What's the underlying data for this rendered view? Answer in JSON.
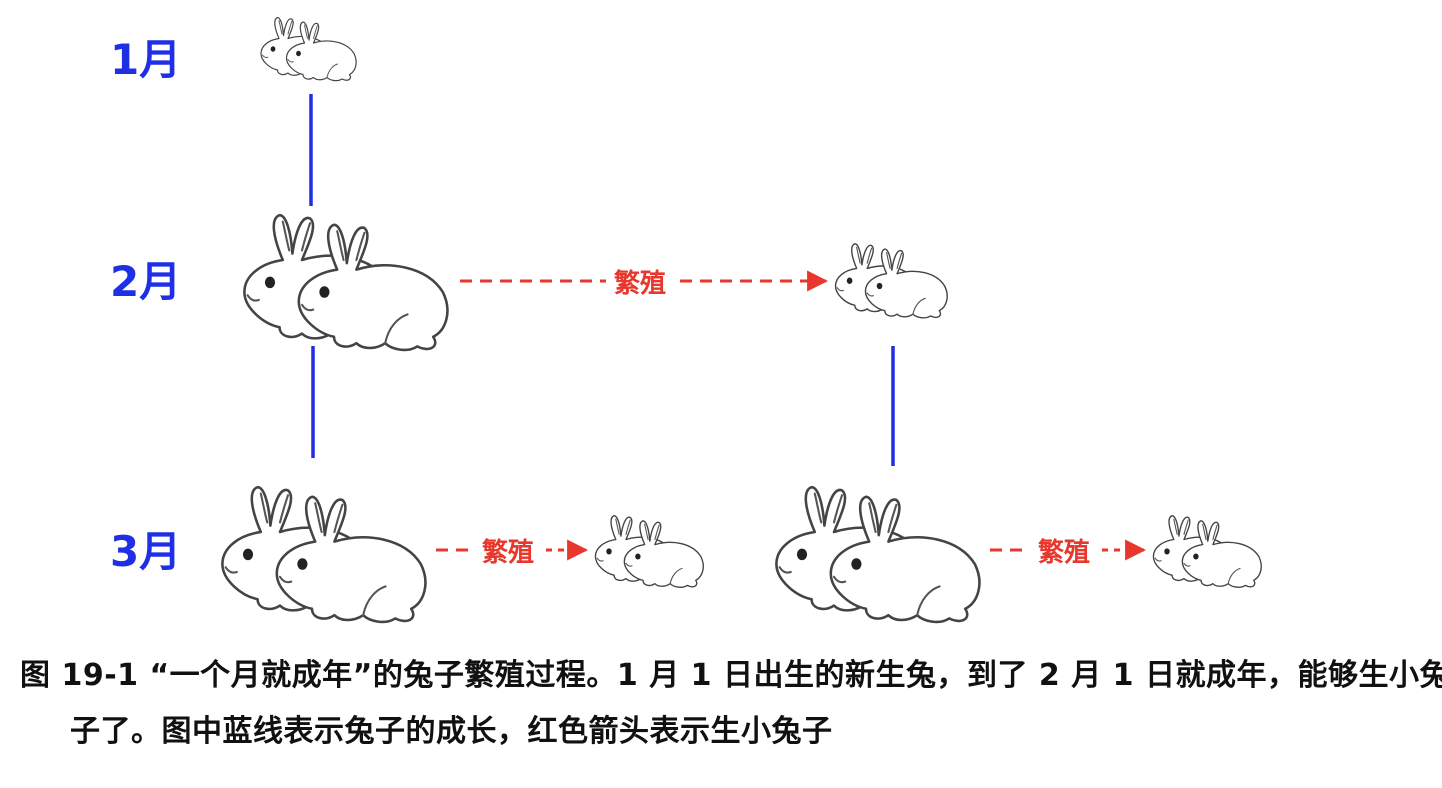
{
  "diagram": {
    "months": [
      "1月",
      "2月",
      "3月"
    ],
    "breed_label": "繁殖"
  },
  "caption": "图 19-1 “一个月就成年”的兔子繁殖过程。1 月 1 日出生的新生兔，到了 2 月 1 日就成年，能够生小兔子了。图中蓝线表示兔子的成长，红色箭头表示生小兔子",
  "colors": {
    "growth_line": "#1f2fe6",
    "breed_arrow": "#e8372c"
  }
}
